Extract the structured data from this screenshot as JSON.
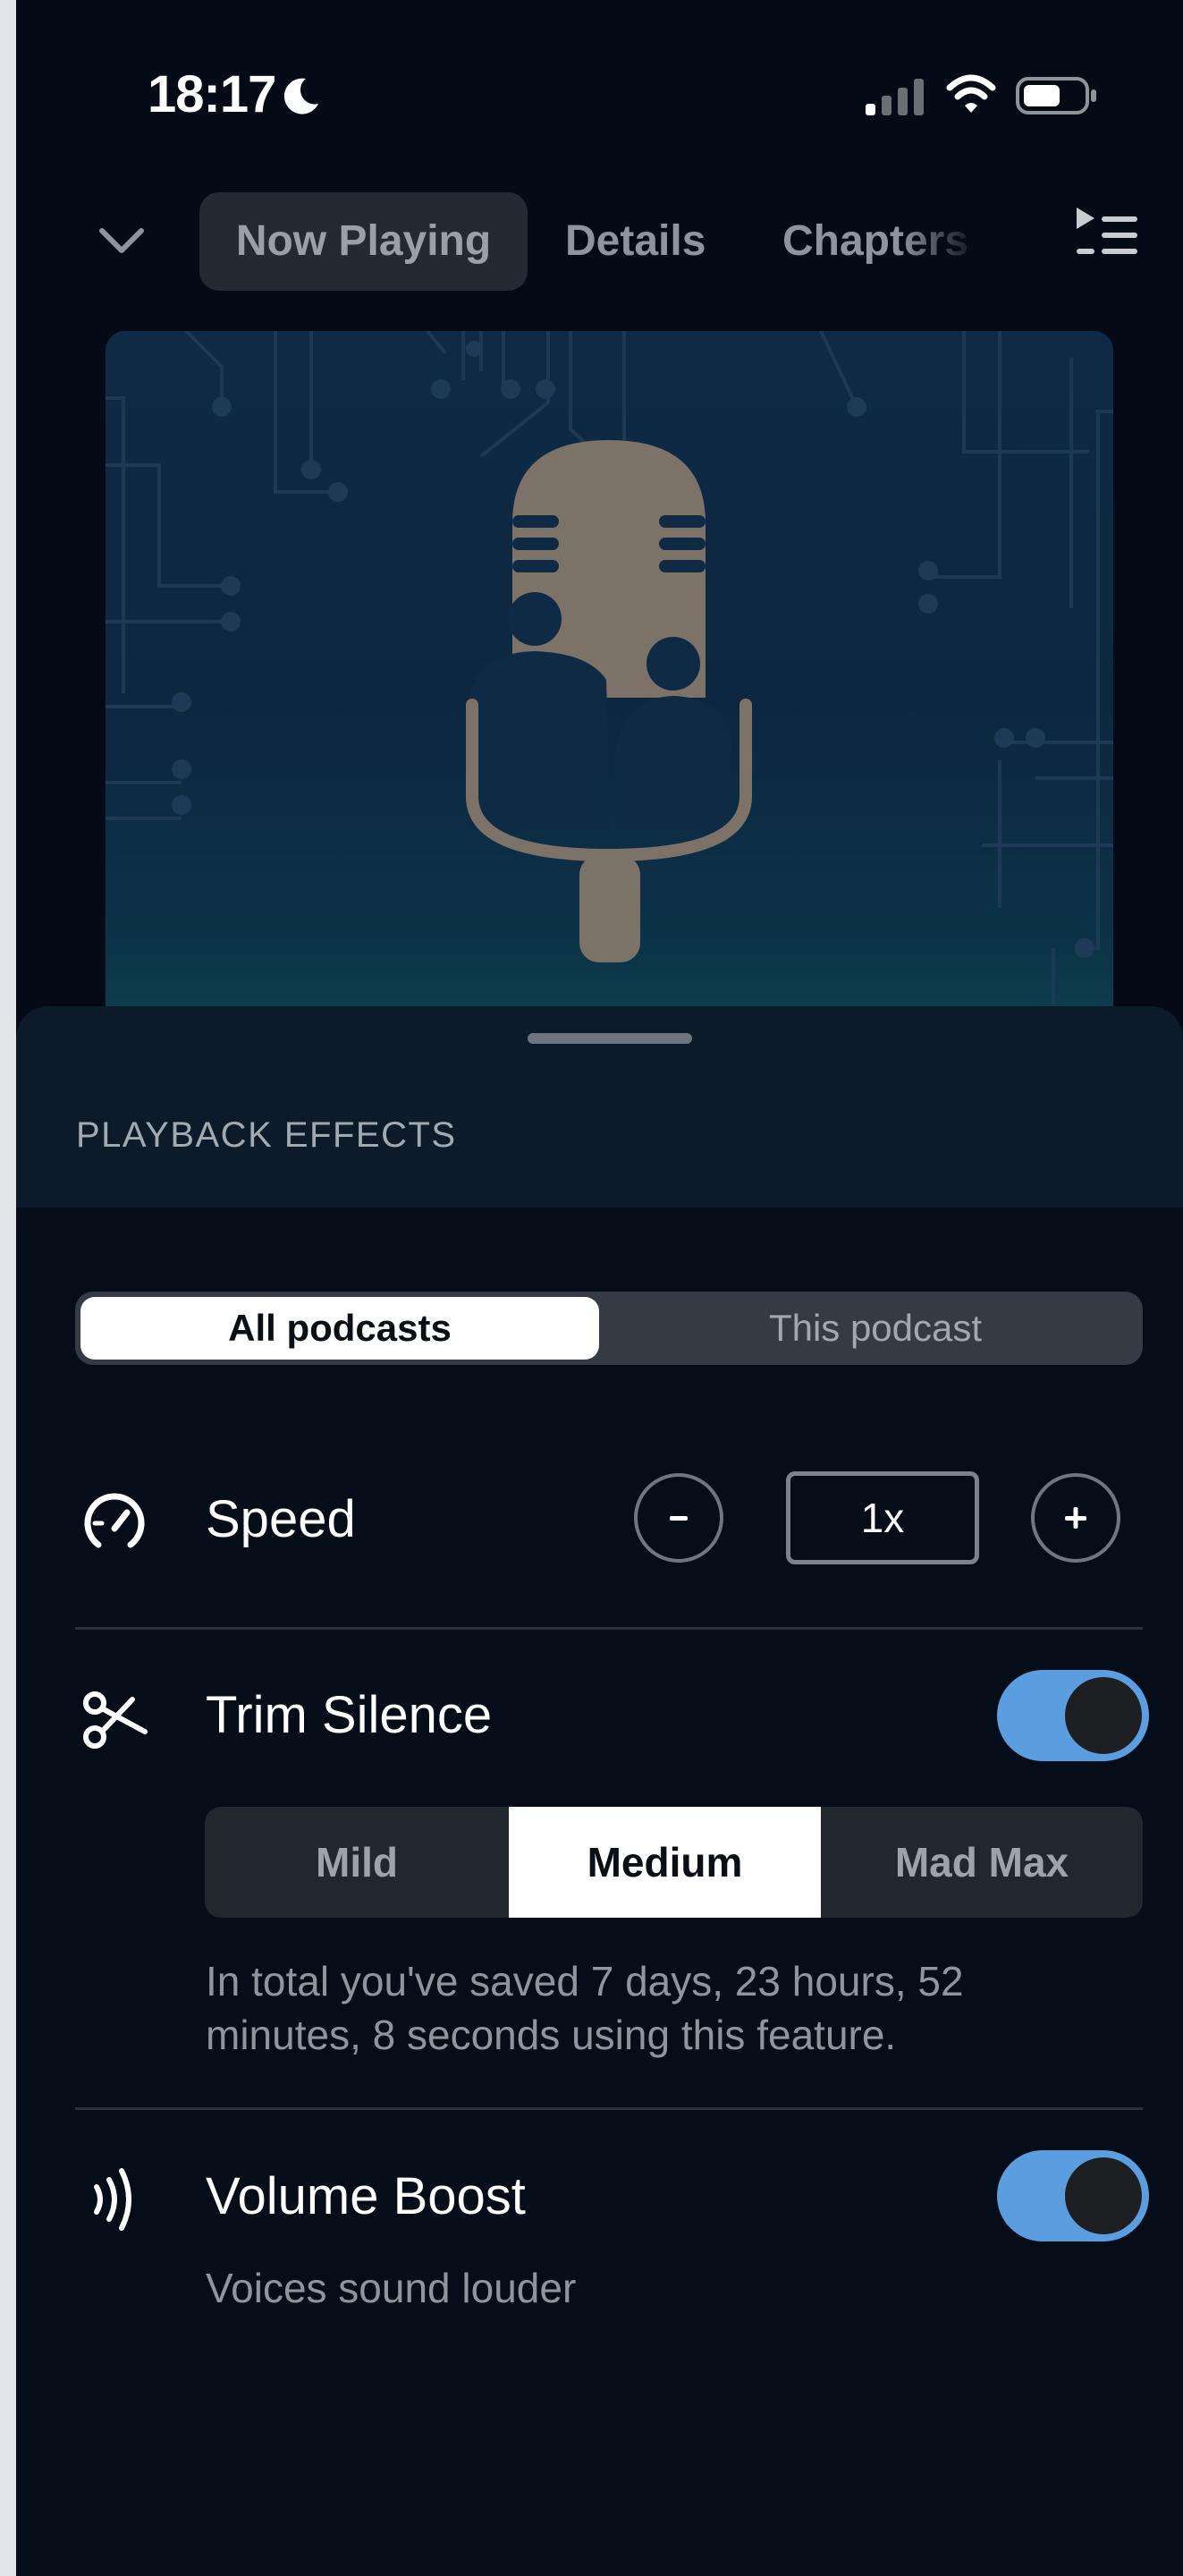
{
  "status_bar": {
    "time": "18:17"
  },
  "nav": {
    "tabs": [
      {
        "label": "Now Playing",
        "selected": true
      },
      {
        "label": "Details",
        "selected": false
      },
      {
        "label": "Chapters",
        "selected": false
      }
    ]
  },
  "sheet": {
    "title": "PLAYBACK EFFECTS",
    "scope": {
      "options": [
        "All podcasts",
        "This podcast"
      ],
      "selected": "All podcasts"
    },
    "speed": {
      "label": "Speed",
      "value": "1x"
    },
    "trim_silence": {
      "label": "Trim Silence",
      "enabled": true,
      "levels": [
        "Mild",
        "Medium",
        "Mad Max"
      ],
      "selected_level": "Medium",
      "caption": "In total you've saved 7 days, 23 hours, 52 minutes, 8 seconds using this feature."
    },
    "volume_boost": {
      "label": "Volume Boost",
      "enabled": true,
      "caption": "Voices sound louder"
    }
  },
  "colors": {
    "background": "#040b16",
    "toggle_on": "#5b9ee0",
    "sheet_header": "#0c1a2a",
    "artwork_mic": "#7c7268"
  },
  "icons": {
    "collapse": "chevron-down-icon",
    "queue": "queue-list-icon",
    "speed": "speedometer-icon",
    "trim": "scissors-icon",
    "volume": "sound-waves-icon"
  }
}
